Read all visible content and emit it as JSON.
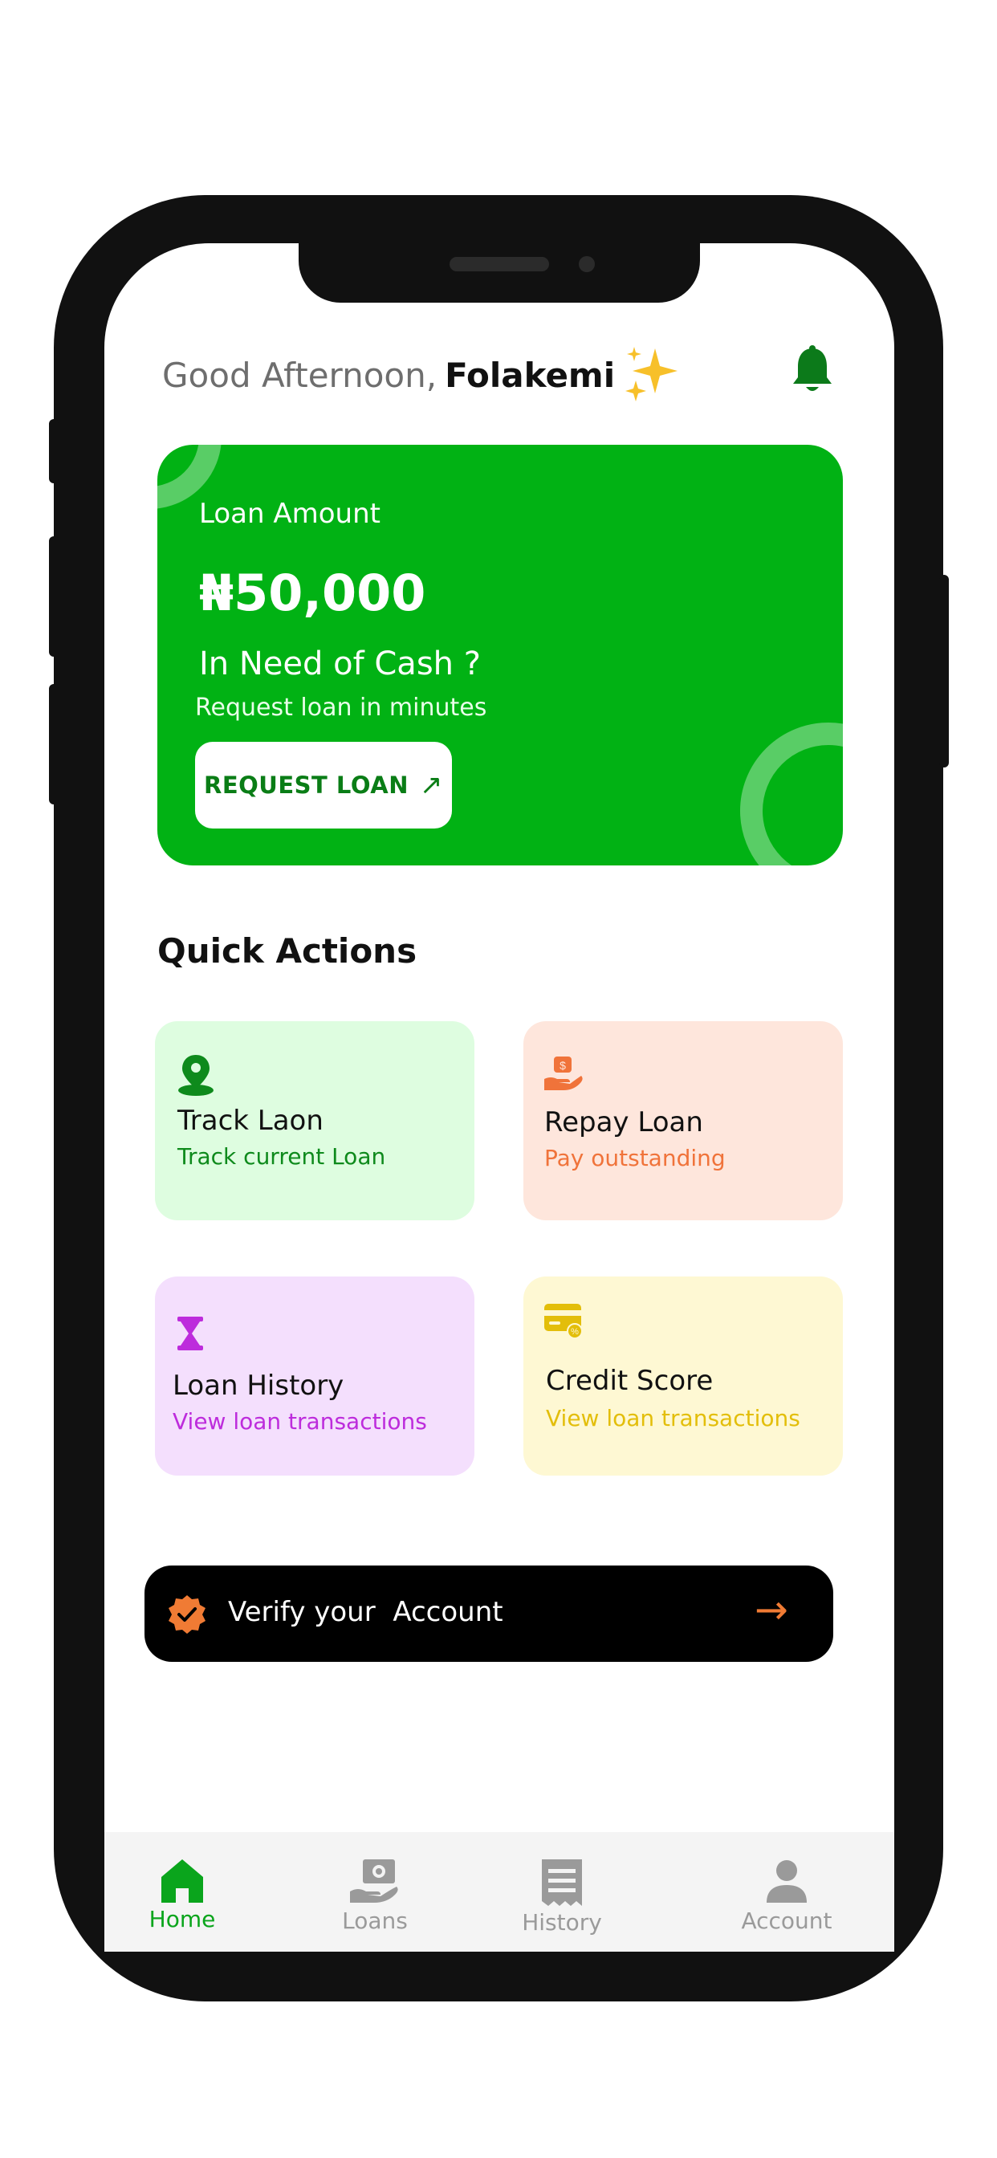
{
  "greeting": {
    "prefix": "Good Afternoon,",
    "name": "Folakemi",
    "emoji": "✨"
  },
  "loan_card": {
    "label": "Loan Amount",
    "amount": "₦50,000",
    "headline": "In Need of Cash ?",
    "subtitle": "Request loan in  minutes",
    "button_label": "REQUEST LOAN",
    "button_icon": "↗"
  },
  "quick_actions": {
    "title": "Quick Actions",
    "items": [
      {
        "title": "Track Laon",
        "subtitle": "Track current Loan",
        "icon": "location-pin-icon",
        "bg": "#defde0",
        "accent": "#0e8a1c"
      },
      {
        "title": "Repay Loan",
        "subtitle": "Pay outstanding",
        "icon": "hand-money-icon",
        "bg": "#fee6dc",
        "accent": "#f0733a"
      },
      {
        "title": "Loan History",
        "subtitle": "View loan transactions",
        "icon": "hourglass-icon",
        "bg": "#f4dffd",
        "accent": "#bd2cdc"
      },
      {
        "title": "Credit Score",
        "subtitle": "View loan transactions",
        "icon": "credit-card-icon",
        "bg": "#fef8d3",
        "accent": "#e3be0a"
      }
    ]
  },
  "verify": {
    "label": "Verify your  Account",
    "arrow": "→",
    "accent": "#f07b34"
  },
  "nav": {
    "items": [
      {
        "label": "Home",
        "icon": "home-icon",
        "active": true
      },
      {
        "label": "Loans",
        "icon": "cash-hand-icon",
        "active": false
      },
      {
        "label": "History",
        "icon": "receipt-icon",
        "active": false
      },
      {
        "label": "Account",
        "icon": "person-icon",
        "active": false
      }
    ]
  },
  "colors": {
    "brand_green": "#01b214",
    "nav_active": "#0aa51c",
    "nav_inactive": "#9a9a9a"
  }
}
